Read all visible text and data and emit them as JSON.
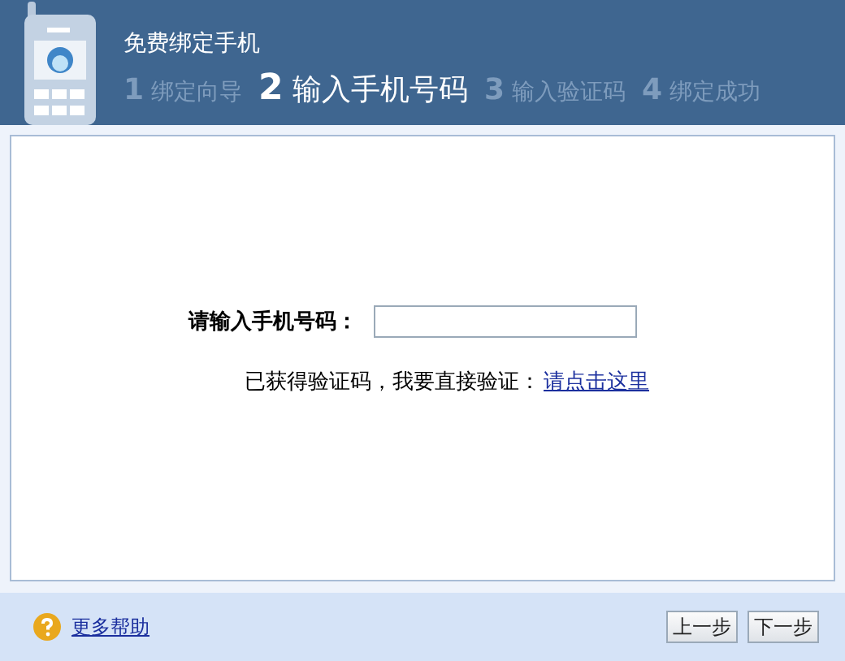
{
  "header": {
    "title": "免费绑定手机",
    "steps": [
      {
        "number": "1",
        "label": "绑定向导",
        "selected": false
      },
      {
        "number": "2",
        "label": "输入手机号码",
        "selected": true
      },
      {
        "number": "3",
        "label": "输入验证码",
        "selected": false
      },
      {
        "number": "4",
        "label": "绑定成功",
        "selected": false
      }
    ]
  },
  "form": {
    "phone_label": "请输入手机号码：",
    "hint": "已获得验证码，我要直接验证：",
    "hint_link": "请点击这里"
  },
  "footer": {
    "help_link": "更多帮助",
    "buttons": [
      "上一步",
      "下一步"
    ]
  }
}
